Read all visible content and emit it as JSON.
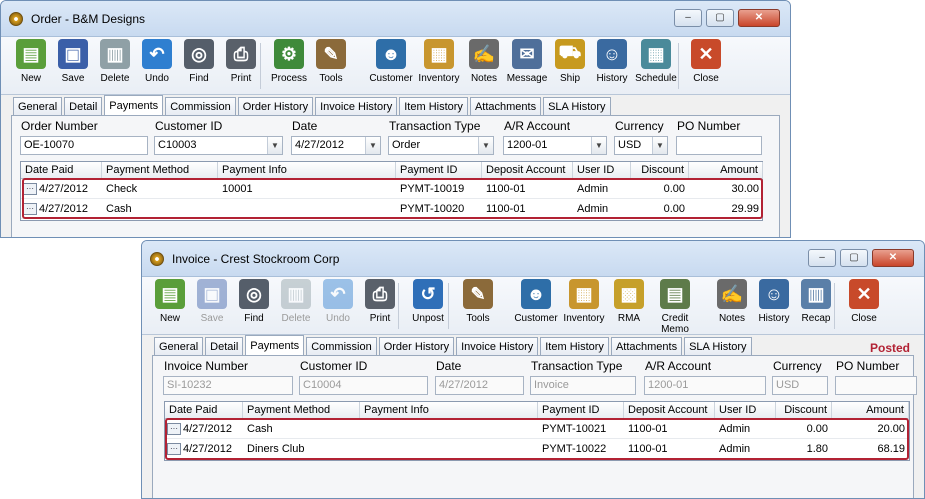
{
  "order_window": {
    "title": "Order - B&M Designs",
    "toolbar": [
      {
        "label": "New",
        "icon": "new-document-icon",
        "color": "#5a9e3a",
        "glyph": "▤",
        "disabled": false
      },
      {
        "label": "Save",
        "icon": "floppy-disk-icon",
        "color": "#3b5fa8",
        "glyph": "▣",
        "disabled": false
      },
      {
        "label": "Delete",
        "icon": "trash-can-icon",
        "color": "#8fa0a6",
        "glyph": "▥",
        "disabled": false
      },
      {
        "label": "Undo",
        "icon": "undo-arrow-icon",
        "color": "#2f7fd0",
        "glyph": "↶",
        "disabled": false
      },
      {
        "label": "Find",
        "icon": "binoculars-icon",
        "color": "#555e6a",
        "glyph": "◎",
        "disabled": false
      },
      {
        "label": "Print",
        "icon": "printer-icon",
        "color": "#59606a",
        "glyph": "⎙",
        "disabled": false
      },
      {
        "label": "Process",
        "icon": "process-gear-icon",
        "color": "#3f8a3a",
        "glyph": "⚙",
        "disabled": false
      },
      {
        "label": "Tools",
        "icon": "tools-icon",
        "color": "#8b6a3a",
        "glyph": "✎",
        "disabled": false
      },
      {
        "label": "Customer",
        "icon": "customer-person-icon",
        "color": "#2e6ea8",
        "glyph": "☻",
        "disabled": false
      },
      {
        "label": "Inventory",
        "icon": "inventory-boxes-icon",
        "color": "#c8962e",
        "glyph": "▦",
        "disabled": false
      },
      {
        "label": "Notes",
        "icon": "notes-pen-icon",
        "color": "#6a6a6a",
        "glyph": "✍",
        "disabled": false
      },
      {
        "label": "Message",
        "icon": "message-icon",
        "color": "#4f6f9a",
        "glyph": "✉",
        "disabled": false
      },
      {
        "label": "Ship",
        "icon": "ship-forklift-icon",
        "color": "#c79a1f",
        "glyph": "⛟",
        "disabled": false
      },
      {
        "label": "History",
        "icon": "history-person-icon",
        "color": "#3a6aa0",
        "glyph": "☺",
        "disabled": false
      },
      {
        "label": "Schedule",
        "icon": "schedule-calendar-icon",
        "color": "#4a8a9a",
        "glyph": "▦",
        "disabled": false
      },
      {
        "label": "Close",
        "icon": "close-window-icon",
        "color": "#c84a2a",
        "glyph": "✕",
        "disabled": false
      }
    ],
    "tabs": [
      "General",
      "Detail",
      "Payments",
      "Commission",
      "Order History",
      "Invoice History",
      "Item History",
      "Attachments",
      "SLA History"
    ],
    "active_tab": "Payments",
    "fields": {
      "order_number": {
        "label": "Order Number",
        "value": "OE-10070"
      },
      "customer_id": {
        "label": "Customer ID",
        "value": "C10003"
      },
      "date": {
        "label": "Date",
        "value": "4/27/2012"
      },
      "transaction_type": {
        "label": "Transaction Type",
        "value": "Order"
      },
      "ar_account": {
        "label": "A/R Account",
        "value": "1200-01"
      },
      "currency": {
        "label": "Currency",
        "value": "USD"
      },
      "po_number": {
        "label": "PO Number",
        "value": ""
      }
    },
    "grid": {
      "columns": [
        "Date Paid",
        "Payment Method",
        "Payment Info",
        "Payment ID",
        "Deposit Account",
        "User ID",
        "Discount",
        "Amount"
      ],
      "rows": [
        {
          "date_paid": "4/27/2012",
          "payment_method": "Check",
          "payment_info": "10001",
          "payment_id": "PYMT-10019",
          "deposit_account": "1100-01",
          "user_id": "Admin",
          "discount": "0.00",
          "amount": "30.00"
        },
        {
          "date_paid": "4/27/2012",
          "payment_method": "Cash",
          "payment_info": "",
          "payment_id": "PYMT-10020",
          "deposit_account": "1100-01",
          "user_id": "Admin",
          "discount": "0.00",
          "amount": "29.99"
        }
      ]
    }
  },
  "invoice_window": {
    "title": "Invoice - Crest Stockroom Corp",
    "status": "Posted",
    "toolbar": [
      {
        "label": "New",
        "icon": "new-document-icon",
        "color": "#5a9e3a",
        "glyph": "▤",
        "disabled": false
      },
      {
        "label": "Save",
        "icon": "floppy-disk-icon",
        "color": "#3b5fa8",
        "glyph": "▣",
        "disabled": true
      },
      {
        "label": "Find",
        "icon": "binoculars-icon",
        "color": "#555e6a",
        "glyph": "◎",
        "disabled": false
      },
      {
        "label": "Delete",
        "icon": "trash-can-icon",
        "color": "#8fa0a6",
        "glyph": "▥",
        "disabled": true
      },
      {
        "label": "Undo",
        "icon": "undo-arrow-icon",
        "color": "#2f7fd0",
        "glyph": "↶",
        "disabled": true
      },
      {
        "label": "Print",
        "icon": "printer-icon",
        "color": "#59606a",
        "glyph": "⎙",
        "disabled": false
      },
      {
        "label": "Unpost",
        "icon": "unpost-icon",
        "color": "#2f6fb8",
        "glyph": "↺",
        "disabled": false
      },
      {
        "label": "Tools",
        "icon": "tools-icon",
        "color": "#8b6a3a",
        "glyph": "✎",
        "disabled": false
      },
      {
        "label": "Customer",
        "icon": "customer-person-icon",
        "color": "#2e6ea8",
        "glyph": "☻",
        "disabled": false
      },
      {
        "label": "Inventory",
        "icon": "inventory-boxes-icon",
        "color": "#c8962e",
        "glyph": "▦",
        "disabled": false
      },
      {
        "label": "RMA",
        "icon": "rma-icon",
        "color": "#c6a02a",
        "glyph": "▩",
        "disabled": false
      },
      {
        "label": "Credit Memo",
        "icon": "credit-memo-icon",
        "color": "#5e7b4a",
        "glyph": "▤",
        "disabled": false
      },
      {
        "label": "Notes",
        "icon": "notes-pen-icon",
        "color": "#6a6a6a",
        "glyph": "✍",
        "disabled": false
      },
      {
        "label": "History",
        "icon": "history-person-icon",
        "color": "#3a6aa0",
        "glyph": "☺",
        "disabled": false
      },
      {
        "label": "Recap",
        "icon": "recap-icon",
        "color": "#5a7fa8",
        "glyph": "▥",
        "disabled": false
      },
      {
        "label": "Close",
        "icon": "close-window-icon",
        "color": "#c84a2a",
        "glyph": "✕",
        "disabled": false
      }
    ],
    "tabs": [
      "General",
      "Detail",
      "Payments",
      "Commission",
      "Order History",
      "Invoice History",
      "Item History",
      "Attachments",
      "SLA History"
    ],
    "active_tab": "Payments",
    "fields": {
      "invoice_number": {
        "label": "Invoice Number",
        "value": "SI-10232"
      },
      "customer_id": {
        "label": "Customer ID",
        "value": "C10004"
      },
      "date": {
        "label": "Date",
        "value": "4/27/2012"
      },
      "transaction_type": {
        "label": "Transaction Type",
        "value": "Invoice"
      },
      "ar_account": {
        "label": "A/R Account",
        "value": "1200-01"
      },
      "currency": {
        "label": "Currency",
        "value": "USD"
      },
      "po_number": {
        "label": "PO Number",
        "value": ""
      }
    },
    "grid": {
      "columns": [
        "Date Paid",
        "Payment Method",
        "Payment Info",
        "Payment ID",
        "Deposit Account",
        "User ID",
        "Discount",
        "Amount"
      ],
      "rows": [
        {
          "date_paid": "4/27/2012",
          "payment_method": "Cash",
          "payment_info": "",
          "payment_id": "PYMT-10021",
          "deposit_account": "1100-01",
          "user_id": "Admin",
          "discount": "0.00",
          "amount": "20.00"
        },
        {
          "date_paid": "4/27/2012",
          "payment_method": "Diners Club",
          "payment_info": "",
          "payment_id": "PYMT-10022",
          "deposit_account": "1100-01",
          "user_id": "Admin",
          "discount": "1.80",
          "amount": "68.19"
        }
      ]
    }
  },
  "colors": {
    "highlight": "#b22234",
    "posted": "#b22234",
    "title_bar": "#c8daf0"
  }
}
